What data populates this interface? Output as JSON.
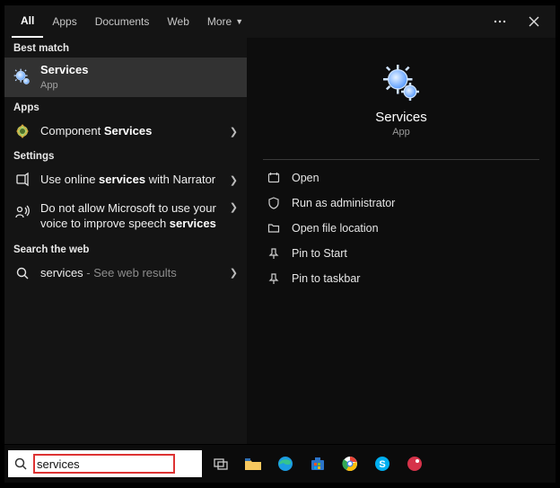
{
  "tabs": [
    "All",
    "Apps",
    "Documents",
    "Web",
    "More"
  ],
  "active_tab_index": 0,
  "left": {
    "best_match_label": "Best match",
    "best_match": {
      "title": "Services",
      "subtitle": "App"
    },
    "apps_label": "Apps",
    "apps": [
      {
        "pre": "Component ",
        "bold": "Services"
      }
    ],
    "settings_label": "Settings",
    "settings": [
      {
        "pre": "Use online ",
        "bold": "services",
        "post": " with Narrator"
      },
      {
        "pre": "Do not allow Microsoft to use your voice to improve speech ",
        "bold": "services"
      }
    ],
    "web_label": "Search the web",
    "web": {
      "term": "services",
      "suffix": " - See web results"
    }
  },
  "right": {
    "title": "Services",
    "subtitle": "App",
    "actions": [
      "Open",
      "Run as administrator",
      "Open file location",
      "Pin to Start",
      "Pin to taskbar"
    ]
  },
  "search": {
    "value": "services"
  }
}
